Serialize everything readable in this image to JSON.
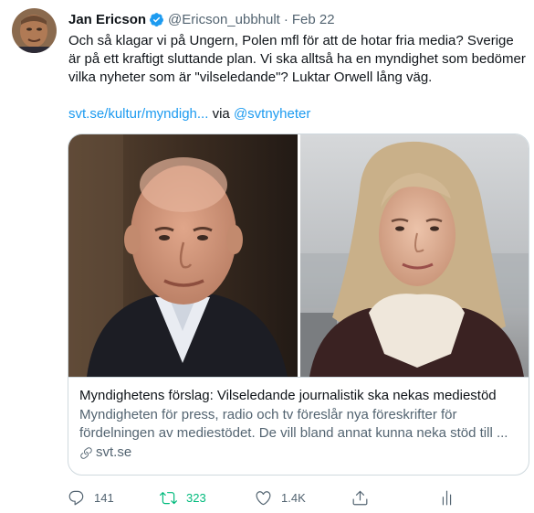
{
  "tweet": {
    "author_name": "Jan Ericson",
    "handle": "@Ericson_ubbhult",
    "separator": "·",
    "date": "Feb 22",
    "text": "Och så klagar vi på Ungern, Polen mfl för att de hotar fria media? Sverige är på ett kraftigt sluttande plan. Vi ska alltså ha en myndighet som bedömer vilka nyheter som är \"vilseledande\"? Luktar Orwell lång väg.",
    "link_text": "svt.se/kultur/myndigh...",
    "via_text": "via",
    "via_handle": "@svtnyheter"
  },
  "card": {
    "title": "Myndighetens förslag: Vilseledande journalistik ska nekas mediestöd",
    "description": "Myndigheten för press, radio och tv föreslår nya föreskrifter för fördelningen av mediestödet. De vill bland annat kunna neka stöd till ...",
    "domain": "svt.se"
  },
  "actions": {
    "replies": "141",
    "retweets": "323",
    "likes": "1.4K"
  },
  "colors": {
    "accent": "#1d9bf0",
    "retweet": "#00ba7c",
    "muted": "#536471"
  }
}
